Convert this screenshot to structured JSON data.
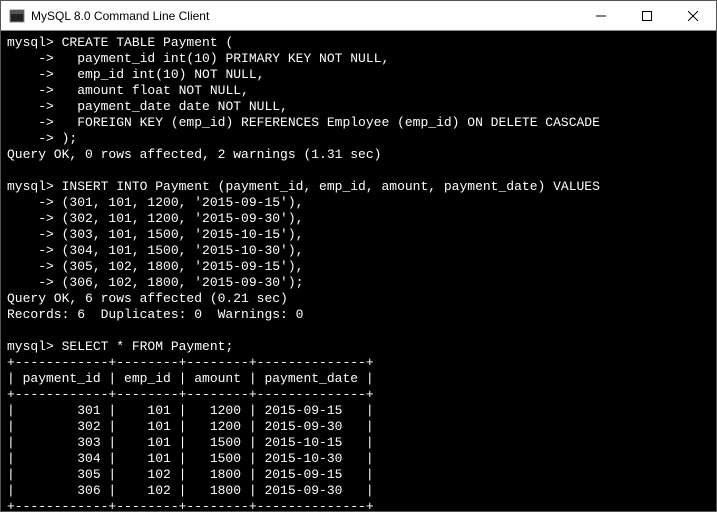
{
  "window": {
    "title": "MySQL 8.0 Command Line Client"
  },
  "console": {
    "prompt": "mysql>",
    "cont": "    ->",
    "lines": {
      "create1": " CREATE TABLE Payment (",
      "create2": "   payment_id int(10) PRIMARY KEY NOT NULL,",
      "create3": "   emp_id int(10) NOT NULL,",
      "create4": "   amount float NOT NULL,",
      "create5": "   payment_date date NOT NULL,",
      "create6": "   FOREIGN KEY (emp_id) REFERENCES Employee (emp_id) ON DELETE CASCADE",
      "create7": " );",
      "query_ok1": "Query OK, 0 rows affected, 2 warnings (1.31 sec)",
      "blank": "",
      "insert1": " INSERT INTO Payment (payment_id, emp_id, amount, payment_date) VALUES",
      "insert2": " (301, 101, 1200, '2015-09-15'),",
      "insert3": " (302, 101, 1200, '2015-09-30'),",
      "insert4": " (303, 101, 1500, '2015-10-15'),",
      "insert5": " (304, 101, 1500, '2015-10-30'),",
      "insert6": " (305, 102, 1800, '2015-09-15'),",
      "insert7": " (306, 102, 1800, '2015-09-30');",
      "query_ok2": "Query OK, 6 rows affected (0.21 sec)",
      "records": "Records: 6  Duplicates: 0  Warnings: 0",
      "select": " SELECT * FROM Payment;",
      "sep": "+------------+--------+--------+--------------+",
      "header": "| payment_id | emp_id | amount | payment_date |",
      "row1": "|        301 |    101 |   1200 | 2015-09-15   |",
      "row2": "|        302 |    101 |   1200 | 2015-09-30   |",
      "row3": "|        303 |    101 |   1500 | 2015-10-15   |",
      "row4": "|        304 |    101 |   1500 | 2015-10-30   |",
      "row5": "|        305 |    102 |   1800 | 2015-09-15   |",
      "row6": "|        306 |    102 |   1800 | 2015-09-30   |"
    }
  },
  "chart_data": {
    "type": "table",
    "title": "Payment",
    "columns": [
      "payment_id",
      "emp_id",
      "amount",
      "payment_date"
    ],
    "rows": [
      [
        301,
        101,
        1200,
        "2015-09-15"
      ],
      [
        302,
        101,
        1200,
        "2015-09-30"
      ],
      [
        303,
        101,
        1500,
        "2015-10-15"
      ],
      [
        304,
        101,
        1500,
        "2015-10-30"
      ],
      [
        305,
        102,
        1800,
        "2015-09-15"
      ],
      [
        306,
        102,
        1800,
        "2015-09-30"
      ]
    ]
  }
}
